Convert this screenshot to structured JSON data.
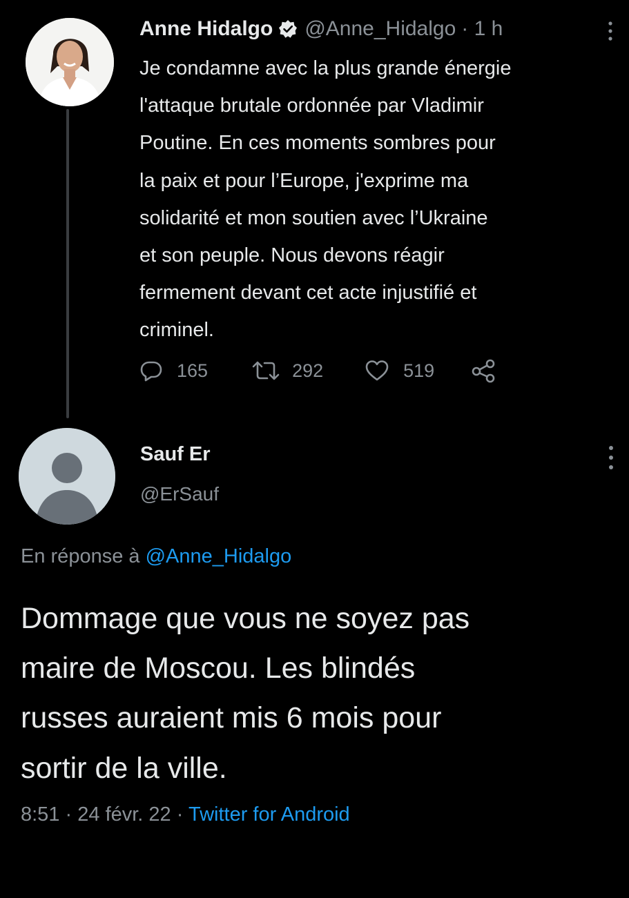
{
  "tweet": {
    "author_name": "Anne Hidalgo",
    "author_handle": "@Anne_Hidalgo",
    "time_ago": "· 1 h",
    "text_lines": [
      "Je condamne avec la plus grande énergie",
      "l'attaque brutale ordonnée par Vladimir",
      "Poutine. En ces moments sombres pour",
      "la paix et pour l’Europe, j'exprime ma",
      "solidarité et mon soutien avec l’Ukraine",
      "et son peuple. Nous devons réagir",
      "fermement devant cet acte injustifié et",
      "criminel."
    ],
    "replies": "165",
    "retweets": "292",
    "likes": "519",
    "verified": true
  },
  "reply": {
    "author_name": "Sauf Er",
    "author_handle": "@ErSauf",
    "in_reply_prefix": "En réponse à",
    "in_reply_handle": "@Anne_Hidalgo",
    "text_lines": [
      "Dommage que vous ne soyez pas",
      "maire de Moscou. Les blindés",
      "russes auraient mis 6 mois pour",
      "sortir de la ville."
    ],
    "time": "8:51",
    "date": "24 févr. 22",
    "source": "Twitter for Android"
  },
  "icons": {
    "verified": "verified-badge-icon",
    "more": "more-vertical-icon",
    "reply": "reply-icon",
    "retweet": "retweet-icon",
    "like": "heart-icon",
    "share": "share-icon"
  },
  "colors": {
    "background": "#000000",
    "text": "#e7e9ea",
    "muted": "#8b9197",
    "link": "#1d9bf0",
    "thread_line": "#3a3d40",
    "default_avatar_bg": "#cfd9de",
    "default_avatar_fg": "#687078"
  }
}
